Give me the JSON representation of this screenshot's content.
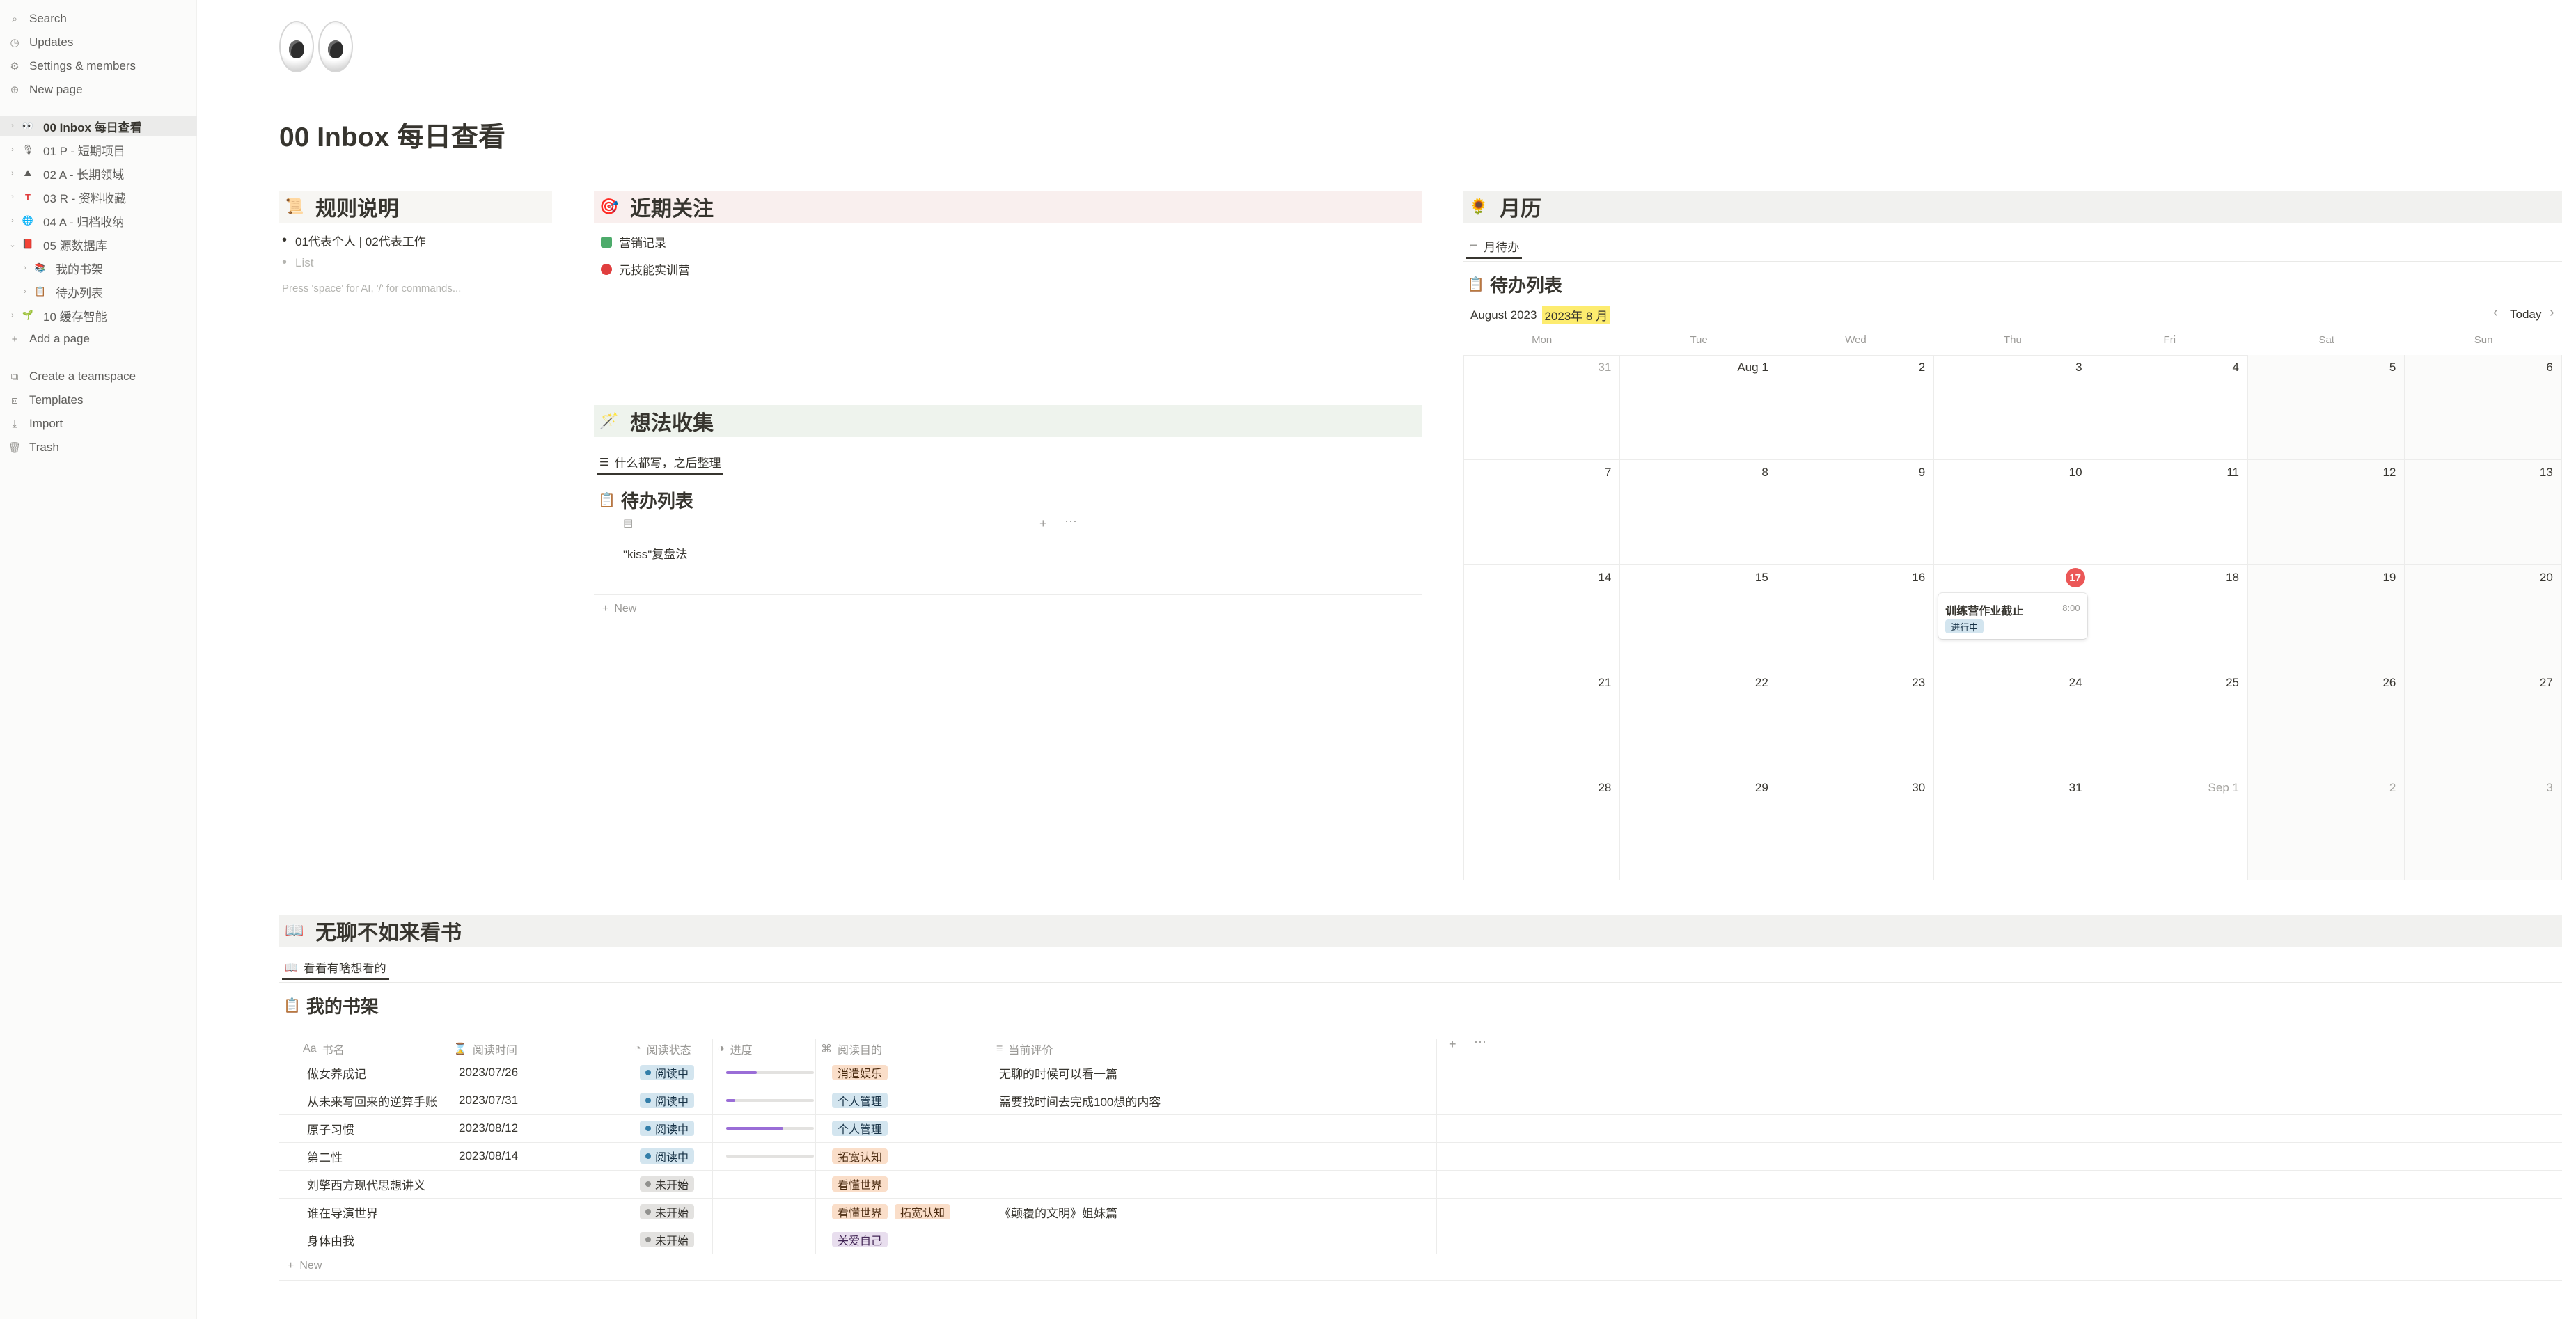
{
  "sidebar": {
    "top": [
      {
        "label": "Search",
        "icon": "search-icon"
      },
      {
        "label": "Updates",
        "icon": "clock-icon"
      },
      {
        "label": "Settings & members",
        "icon": "gear-icon"
      },
      {
        "label": "New page",
        "icon": "plus-circle-icon"
      }
    ],
    "pages": [
      {
        "label": "00 Inbox 每日查看",
        "emoji": "••"
      },
      {
        "label": "01 P - 短期项目",
        "emoji": "🎙"
      },
      {
        "label": "02 A - 长期领域",
        "emoji": "⛰"
      },
      {
        "label": "03 R - 资料收藏",
        "emoji": "T"
      },
      {
        "label": "04 A - 归档收纳",
        "emoji": "🌐"
      },
      {
        "label": "05 源数据库",
        "emoji": "📕"
      },
      {
        "label": "我的书架",
        "emoji": "📚"
      },
      {
        "label": "待办列表",
        "emoji": "📋"
      },
      {
        "label": "10 缓存智能",
        "emoji": "🌱"
      }
    ],
    "add_page": "Add a page",
    "bottom": [
      {
        "label": "Create a teamspace",
        "icon": "teamspace-icon"
      },
      {
        "label": "Templates",
        "icon": "templates-icon"
      },
      {
        "label": "Import",
        "icon": "import-icon"
      },
      {
        "label": "Trash",
        "icon": "trash-icon"
      }
    ]
  },
  "page": {
    "title": "00 Inbox 每日查看"
  },
  "rules": {
    "heading": "规则说明",
    "bullets": [
      "01代表个人 | 02代表工作"
    ],
    "placeholder_bullet": "List",
    "hint": "Press 'space' for AI, '/' for commands..."
  },
  "focus": {
    "heading": "近期关注",
    "links": [
      "营销记录",
      "元技能实训营"
    ]
  },
  "ideas": {
    "heading": "想法收集",
    "tab": "什么都写，之后整理",
    "db_title": "待办列表",
    "rows": [
      "\"kiss\"复盘法"
    ],
    "new_label": "New"
  },
  "calendar": {
    "heading": "月历",
    "tab": "月待办",
    "db_title": "待办列表",
    "month_label": "August 2023",
    "month_highlight": "2023年 8 月",
    "today_label": "Today",
    "weekdays": [
      "Mon",
      "Tue",
      "Wed",
      "Thu",
      "Fri",
      "Sat",
      "Sun"
    ],
    "weeks": [
      [
        "31",
        "Aug 1",
        "2",
        "3",
        "4",
        "5",
        "6"
      ],
      [
        "7",
        "8",
        "9",
        "10",
        "11",
        "12",
        "13"
      ],
      [
        "14",
        "15",
        "16",
        "17",
        "18",
        "19",
        "20"
      ],
      [
        "21",
        "22",
        "23",
        "24",
        "25",
        "26",
        "27"
      ],
      [
        "28",
        "29",
        "30",
        "31",
        "Sep 1",
        "2",
        "3"
      ]
    ],
    "event": {
      "title": "训练营作业截止",
      "time": "8:00",
      "status": "进行中"
    }
  },
  "books": {
    "heading": "无聊不如来看书",
    "tab": "看看有啥想看的",
    "db_title": "我的书架",
    "columns": [
      "书名",
      "阅读时间",
      "阅读状态",
      "进度",
      "阅读目的",
      "当前评价"
    ],
    "rows": [
      {
        "name": "做女养成记",
        "date": "2023/07/26",
        "status": "阅读中",
        "progress": 0.35,
        "tags": [
          "消遣娱乐"
        ],
        "review": "无聊的时候可以看一篇"
      },
      {
        "name": "从未来写回来的逆算手账",
        "date": "2023/07/31",
        "status": "阅读中",
        "progress": 0.1,
        "tags": [
          "个人管理"
        ],
        "review": "需要找时间去完成100想的内容"
      },
      {
        "name": "原子习惯",
        "date": "2023/08/12",
        "status": "阅读中",
        "progress": 0.65,
        "tags": [
          "个人管理"
        ],
        "review": ""
      },
      {
        "name": "第二性",
        "date": "2023/08/14",
        "status": "阅读中",
        "progress": 0.0,
        "tags": [
          "拓宽认知"
        ],
        "review": ""
      },
      {
        "name": "刘擎西方现代思想讲义",
        "date": "",
        "status": "未开始",
        "progress": null,
        "tags": [
          "看懂世界"
        ],
        "review": ""
      },
      {
        "name": "谁在导演世界",
        "date": "",
        "status": "未开始",
        "progress": null,
        "tags": [
          "看懂世界",
          "拓宽认知"
        ],
        "review": "《颠覆的文明》姐妹篇"
      },
      {
        "name": "身体由我",
        "date": "",
        "status": "未开始",
        "progress": null,
        "tags": [
          "关爱自己"
        ],
        "review": ""
      }
    ],
    "new_label": "New"
  },
  "colors": {
    "today": "#eb5757",
    "progress": "#9a6dd7",
    "highlight": "#fdec6f"
  }
}
